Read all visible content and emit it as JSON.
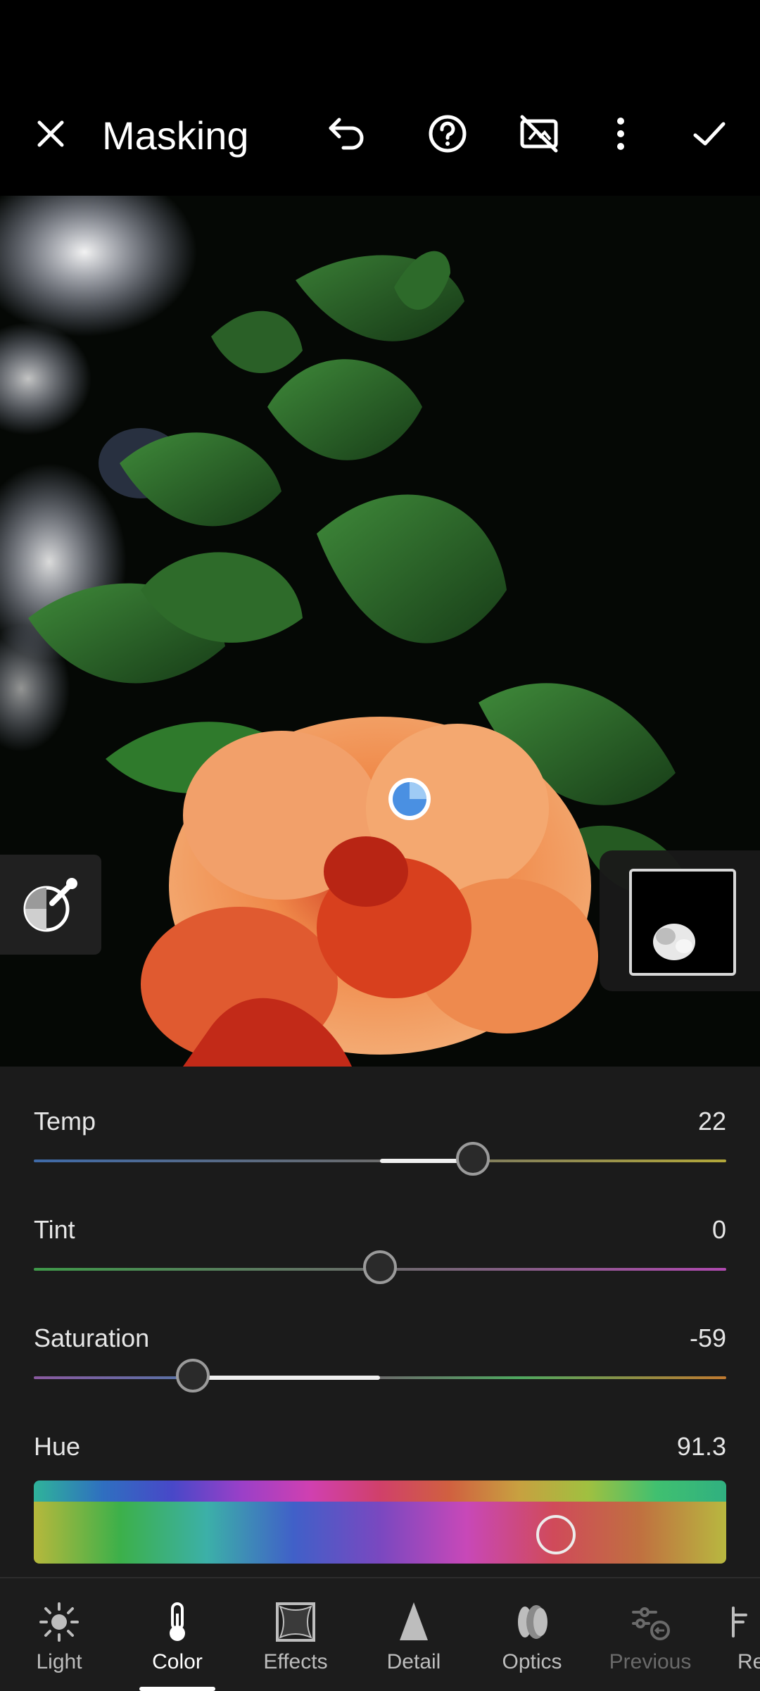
{
  "header": {
    "title": "Masking"
  },
  "adjustments": {
    "temp": {
      "label": "Temp",
      "value": "22"
    },
    "tint": {
      "label": "Tint",
      "value": "0"
    },
    "saturation": {
      "label": "Saturation",
      "value": "-59"
    },
    "hue": {
      "label": "Hue",
      "value": "91.3"
    }
  },
  "toolbar": {
    "items": [
      {
        "label": "Light",
        "icon": "sun-icon"
      },
      {
        "label": "Color",
        "icon": "thermometer-icon",
        "active": true
      },
      {
        "label": "Effects",
        "icon": "vignette-icon"
      },
      {
        "label": "Detail",
        "icon": "triangle-icon"
      },
      {
        "label": "Optics",
        "icon": "lens-icon"
      },
      {
        "label": "Previous",
        "icon": "sliders-back-icon",
        "disabled": true
      },
      {
        "label": "Re",
        "icon": "reset-icon"
      }
    ]
  },
  "colors": {
    "accent": "#ffffff",
    "panel": "#1c1c1c",
    "background": "#000000"
  }
}
